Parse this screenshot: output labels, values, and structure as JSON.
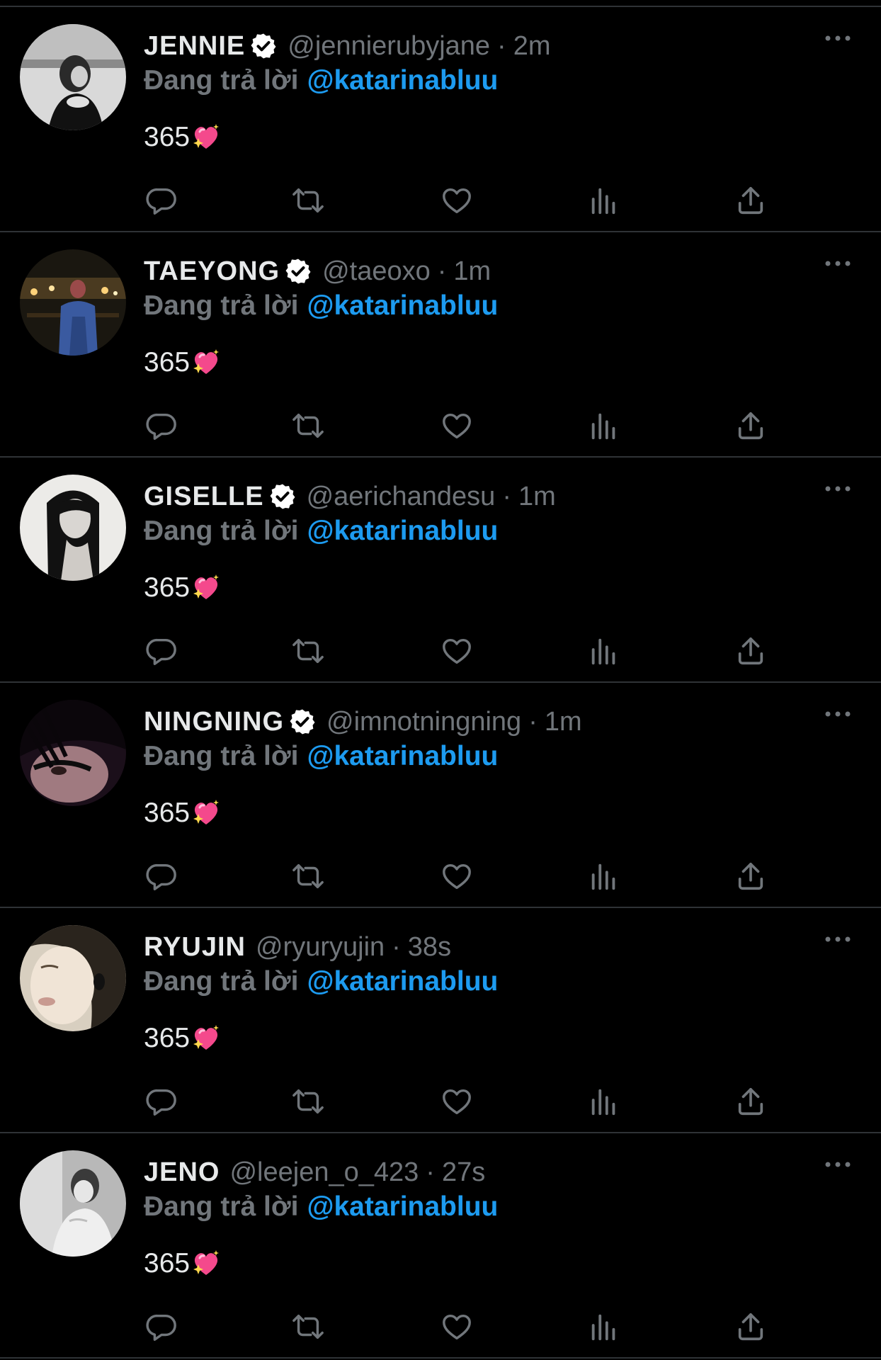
{
  "reply_prefix": "Đang trả lời",
  "colors": {
    "background": "#000000",
    "divider": "#2f3336",
    "text_primary": "#e7e9ea",
    "text_secondary": "#71767b",
    "link": "#1d9bf0",
    "verified_badge_fill": "#ffffff"
  },
  "action_icons": [
    "reply-icon",
    "retweet-icon",
    "like-icon",
    "views-icon",
    "share-icon"
  ],
  "tweets": [
    {
      "name": "JENNIE",
      "verified": true,
      "handle": "@jennierubyjane",
      "separator": "·",
      "time": "2m",
      "reply_to": "@katarinabluu",
      "text": "365",
      "emoji": "sparkling-heart"
    },
    {
      "name": "TAEYONG",
      "verified": true,
      "handle": "@taeoxo",
      "separator": "·",
      "time": "1m",
      "reply_to": "@katarinabluu",
      "text": "365",
      "emoji": "sparkling-heart"
    },
    {
      "name": "GISELLE",
      "verified": true,
      "handle": "@aerichandesu",
      "separator": "·",
      "time": "1m",
      "reply_to": "@katarinabluu",
      "text": "365",
      "emoji": "sparkling-heart"
    },
    {
      "name": "NINGNING",
      "verified": true,
      "handle": "@imnotningning",
      "separator": "·",
      "time": "1m",
      "reply_to": "@katarinabluu",
      "text": "365",
      "emoji": "sparkling-heart"
    },
    {
      "name": "RYUJIN",
      "verified": false,
      "handle": "@ryuryujin",
      "separator": "·",
      "time": "38s",
      "reply_to": "@katarinabluu",
      "text": "365",
      "emoji": "sparkling-heart"
    },
    {
      "name": "JENO",
      "verified": false,
      "handle": "@leejen_o_423",
      "separator": "·",
      "time": "27s",
      "reply_to": "@katarinabluu",
      "text": "365",
      "emoji": "sparkling-heart"
    }
  ]
}
